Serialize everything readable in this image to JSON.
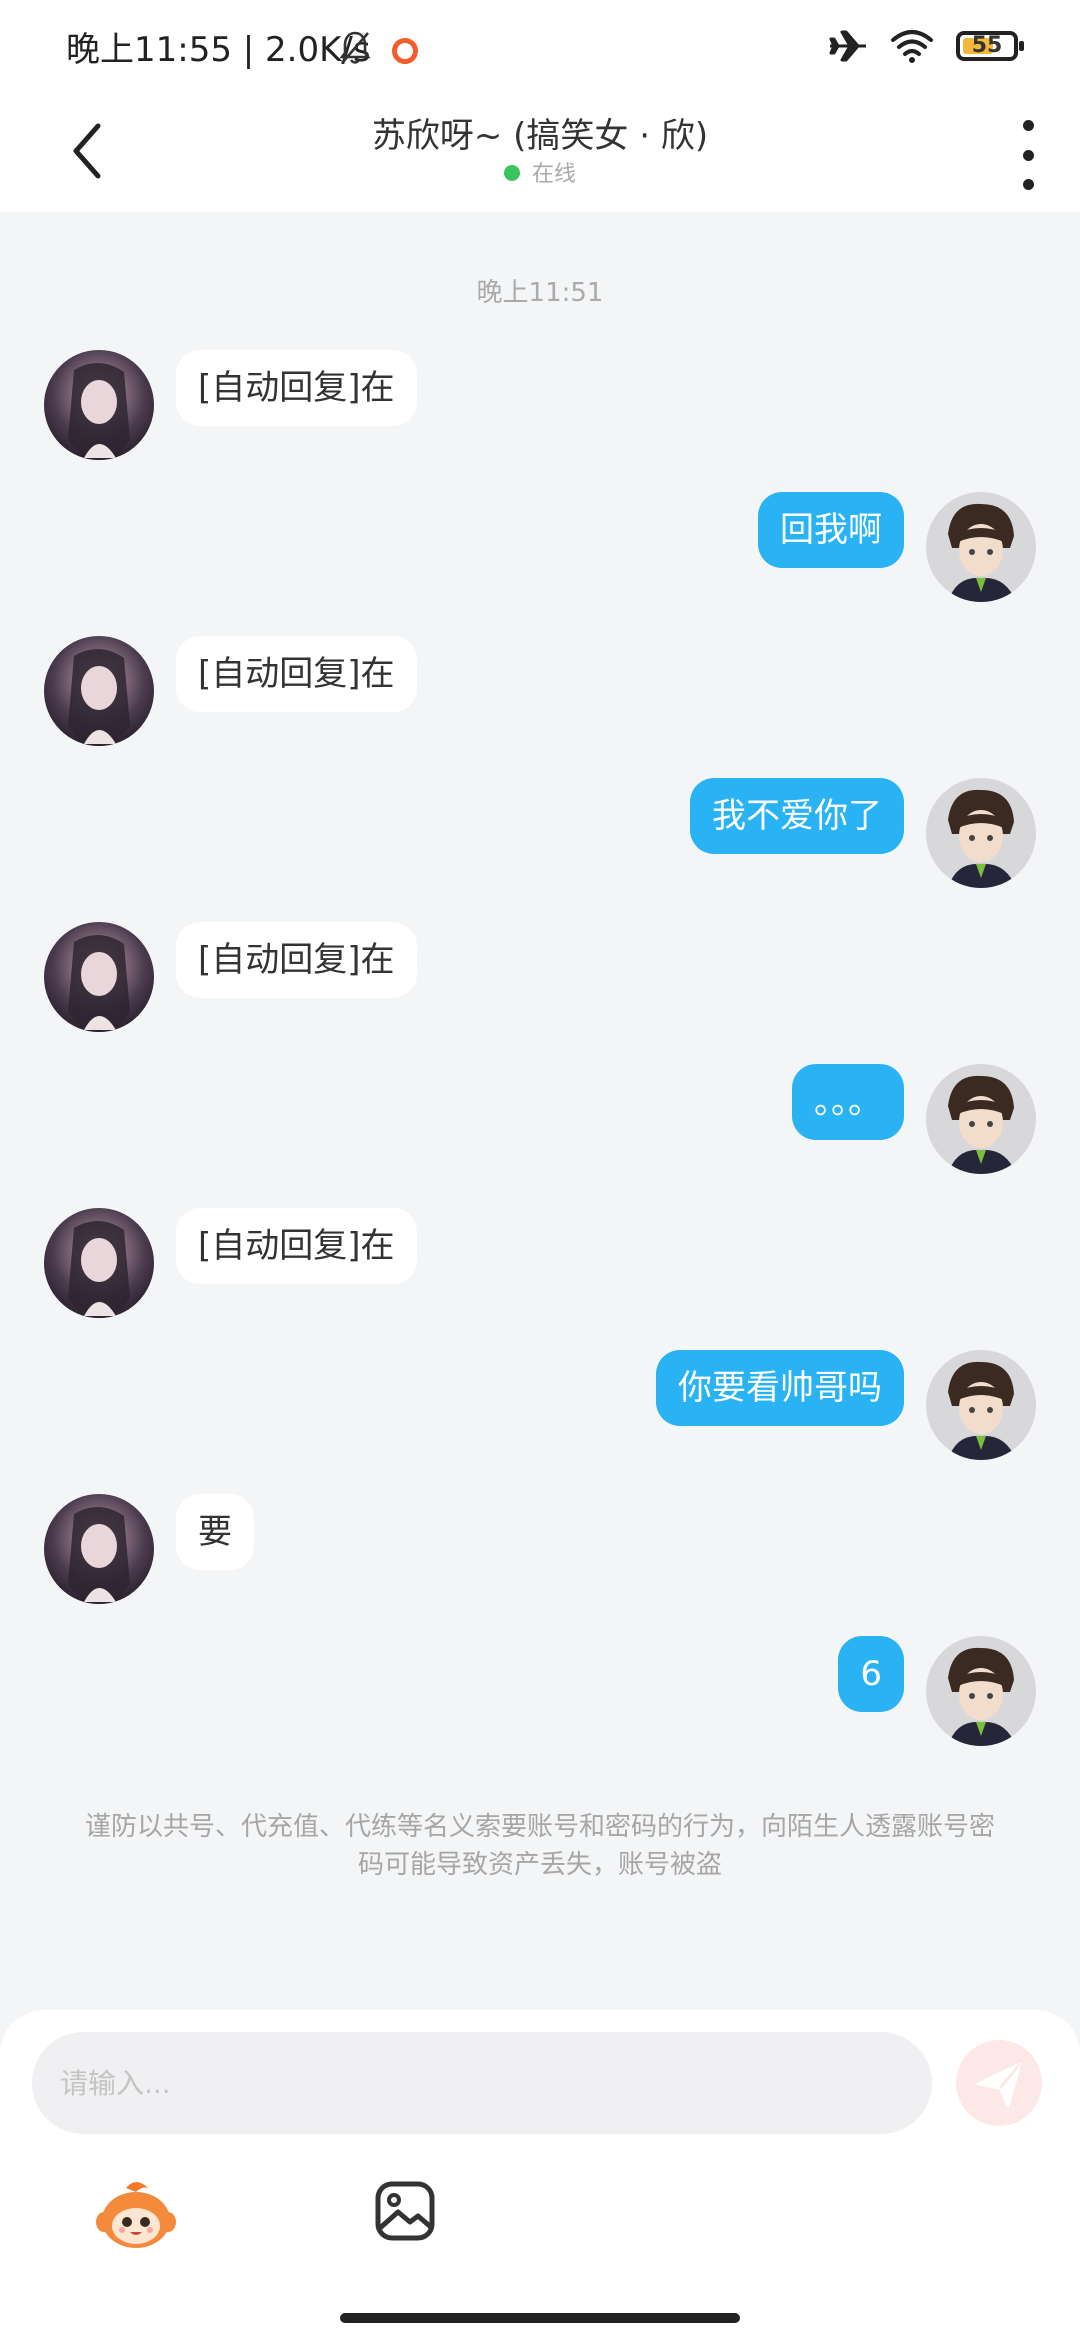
{
  "status_bar": {
    "left_text": "晚上11:55 | 2.0K/s",
    "battery": "55"
  },
  "header": {
    "title": "苏欣呀~ (搞笑女 · 欣)",
    "status": "在线"
  },
  "chat": {
    "timestamp": "晚上11:51",
    "messages": [
      {
        "side": "in",
        "text": "[自动回复]在"
      },
      {
        "side": "out",
        "text": "回我啊"
      },
      {
        "side": "in",
        "text": "[自动回复]在"
      },
      {
        "side": "out",
        "text": "我不爱你了"
      },
      {
        "side": "in",
        "text": "[自动回复]在"
      },
      {
        "side": "out",
        "text": "。。。"
      },
      {
        "side": "in",
        "text": "[自动回复]在"
      },
      {
        "side": "out",
        "text": "你要看帅哥吗"
      },
      {
        "side": "in",
        "text": "要"
      },
      {
        "side": "out",
        "text": "6"
      }
    ],
    "notice": "谨防以共号、代充值、代练等名义索要账号和密码的行为，向陌生人透露账号密码可能导致资产丢失，账号被盗"
  },
  "composer": {
    "placeholder": "请输入..."
  },
  "colors": {
    "outgoing_bubble": "#2ab3f4",
    "incoming_bubble": "#ffffff",
    "online_dot": "#3ac45d",
    "send_button": "#fde8e8"
  }
}
